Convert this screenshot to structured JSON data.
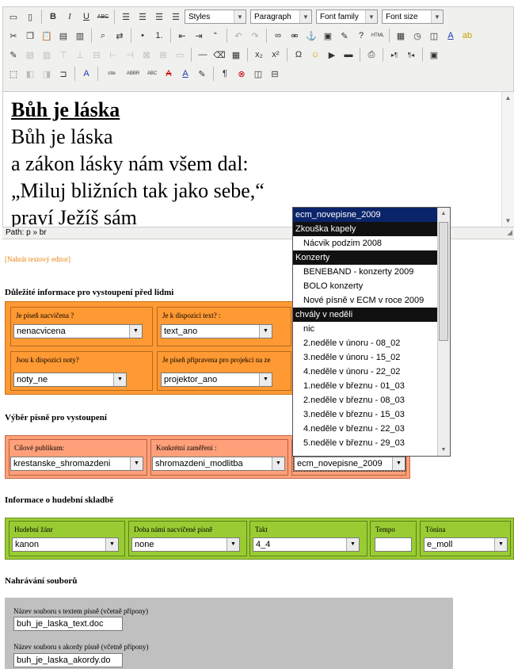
{
  "toolbar": {
    "row1": {
      "bold": "B",
      "italic": "I",
      "underline": "U",
      "strike": "ABC",
      "styles": "Styles",
      "format": "Paragraph",
      "font_family": "Font family",
      "font_size": "Font size"
    },
    "row3": {
      "hr_label": "—",
      "omega": "Ω"
    },
    "row4": {
      "abbr": "ABBR",
      "acronym": "ABC"
    }
  },
  "editor": {
    "heading": "Bůh je láska",
    "lines": [
      "Bůh je láska",
      "a zákon lásky nám všem dal:",
      "„Miluj bližních tak jako sebe,“",
      "praví Ježíš sám"
    ]
  },
  "path": "Path: p » br",
  "switch_editor": "[Nahrát textový editor]",
  "section_important": {
    "title": "Důležité informace pro vystoupení před lidmi",
    "fields": [
      {
        "label": "Je píseň nacvičena ?",
        "value": "nenacvicena"
      },
      {
        "label": "Je k dispozici text? :",
        "value": "text_ano"
      },
      {
        "label": "Jsou k dispozici noty?",
        "value": "noty_ne"
      },
      {
        "label": "Je píseň připravena pro projekci na ze",
        "value": "projektor_ano"
      }
    ]
  },
  "section_choice": {
    "title": "Výběr písně pro vystoupení",
    "fields": [
      {
        "label": "Cílové publikum:",
        "value": "krestanske_shromazdeni"
      },
      {
        "label": "Konkrétní zaměření :",
        "value": "shromazdeni_modlitba"
      },
      {
        "label": "",
        "value": "ecm_novepisne_2009"
      }
    ]
  },
  "section_music": {
    "title": "Informace o hudební skladbě",
    "fields": [
      {
        "label": "Hudební žánr",
        "value": "kanon"
      },
      {
        "label": "Doba námi nacvičené písně",
        "value": "none"
      },
      {
        "label": "Takt",
        "value": "4_4"
      },
      {
        "label": "Tempo",
        "value": ""
      },
      {
        "label": "Tónina",
        "value": "e_moll"
      }
    ]
  },
  "section_upload": {
    "title": "Nahrávání souborů",
    "fields": [
      {
        "label": "Název souboru s textem písně (včetně přípony)",
        "value": "buh_je_laska_text.doc"
      },
      {
        "label": "Název souboru s akordy písně (včetně přípony)",
        "value": "buh_je_laska_akordy.do"
      }
    ]
  },
  "popup": {
    "items": [
      {
        "text": "ecm_novepisne_2009",
        "kind": "selected"
      },
      {
        "text": "Zkouška kapely",
        "kind": "group"
      },
      {
        "text": "Nácvik podzim 2008",
        "kind": "sub"
      },
      {
        "text": "Konzerty",
        "kind": "group"
      },
      {
        "text": "BENEBAND - konzerty 2009",
        "kind": "sub"
      },
      {
        "text": "BOLO konzerty",
        "kind": "sub"
      },
      {
        "text": "Nové písně v ECM v roce 2009",
        "kind": "sub"
      },
      {
        "text": "chvály v neděli",
        "kind": "group"
      },
      {
        "text": "nic",
        "kind": "sub"
      },
      {
        "text": "2.neděle v únoru - 08_02",
        "kind": "sub"
      },
      {
        "text": "3.neděle v únoru - 15_02",
        "kind": "sub"
      },
      {
        "text": "4.neděle v únoru - 22_02",
        "kind": "sub"
      },
      {
        "text": "1.neděle v březnu - 01_03",
        "kind": "sub"
      },
      {
        "text": "2.neděle v březnu - 08_03",
        "kind": "sub"
      },
      {
        "text": "3.neděle v březnu - 15_03",
        "kind": "sub"
      },
      {
        "text": "4.neděle v březnu - 22_03",
        "kind": "sub"
      },
      {
        "text": "5.neděle v březnu - 29_03",
        "kind": "sub"
      }
    ]
  },
  "colors": {
    "orange": "#ff9933",
    "salmon": "#ffa07a",
    "green": "#99cc33",
    "gray": "#c0c0c0",
    "select_blue": "#0a246a"
  }
}
